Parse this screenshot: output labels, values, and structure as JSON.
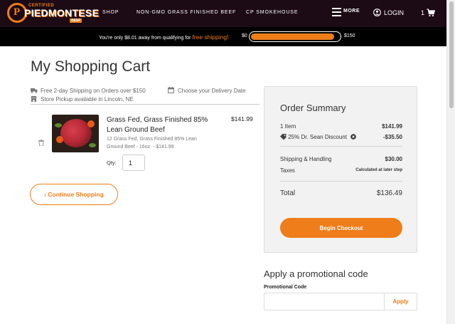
{
  "header": {
    "logo_circle": "P",
    "logo_cert": "CERTIFIED",
    "logo_brand": "PIEDMONTESE",
    "logo_beef": "BEEF",
    "nav": [
      "SHOP",
      "NON-GMO GRASS FINISHED BEEF",
      "CP SMOKEHOUSE"
    ],
    "more_label": "MORE",
    "login_label": "LOGIN",
    "cart_count": "1",
    "icons": [
      "menu-icon",
      "user-icon",
      "cart-icon"
    ]
  },
  "shipping_bar": {
    "text_before": "You're only $8.01 away from qualifying for ",
    "free_text": "free shipping!",
    "min_label": "$0",
    "max_label": "$150",
    "progress_fraction": 0.946
  },
  "main": {
    "title": "My Shopping Cart",
    "info_shipping": "Free 2-day Shipping on Orders over $150",
    "info_delivery": "Choose your Delivery Date",
    "info_pickup": "Store Pickup available in Lincoln, NE",
    "product": {
      "name": "Grass Fed, Grass Finished 85% Lean Ground Beef",
      "desc": "12 Grass Fed, Grass Finished 85% Lean Ground Beef - 16oz. - $141.99",
      "price": "$141.99",
      "qty_label": "Qty:",
      "qty_value": "1"
    },
    "continue_label": "‹ Continue Shopping"
  },
  "summary": {
    "title": "Order Summary",
    "items_label": "1 Item",
    "items_value": "$141.99",
    "discount_label": "25% Dr. Sean Discount",
    "discount_value": "-$35.50",
    "shipping_label": "Shipping & Handling",
    "shipping_value": "$30.00",
    "taxes_label": "Taxes",
    "taxes_value": "Calculated at later step",
    "total_label": "Total",
    "total_value": "$136.49",
    "checkout_label": "Begin Checkout"
  },
  "promo": {
    "title": "Apply a promotional code",
    "label": "Promotional Code",
    "input_value": "",
    "apply_label": "Apply"
  },
  "colors": {
    "accent": "#ee7d1a",
    "header_bg": "#1c0a14",
    "shipbar_bg": "#000000",
    "summary_bg": "#f2f2f2"
  }
}
